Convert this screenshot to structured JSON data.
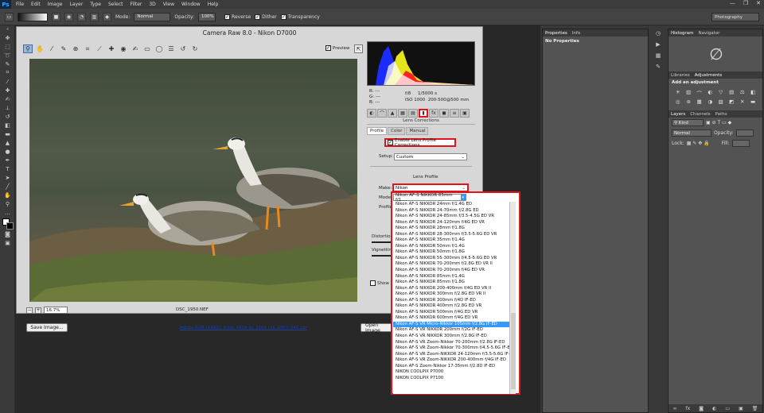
{
  "app": {
    "logo": "Ps"
  },
  "menu": [
    "File",
    "Edit",
    "Image",
    "Layer",
    "Type",
    "Select",
    "Filter",
    "3D",
    "View",
    "Window",
    "Help"
  ],
  "window_controls": [
    "—",
    "❐",
    "✕"
  ],
  "options": {
    "mode_label": "Mode:",
    "mode_value": "Normal",
    "opacity_label": "Opacity:",
    "opacity_value": "100%",
    "reverse": "Reverse",
    "dither": "Dither",
    "transparency": "Transparency",
    "workspace": "Photography"
  },
  "camera_raw": {
    "title": "Camera Raw 8.0  -  Nikon D7000",
    "preview_label": "Preview",
    "zoom_value": "16.7%",
    "filename": "DSC_1950.NEF",
    "save_label": "Save Image...",
    "workflow_link": "Adobe RGB (1998); 8 bit; 4928 by 3264 (16.1MP); 240 ppi",
    "open_label": "Open Image",
    "rgb": {
      "r": "R:  ---",
      "g": "G:  ---",
      "b": "B:  ---"
    },
    "exif": {
      "aperture": "f/8",
      "shutter": "1/5000 s",
      "iso": "ISO 1000",
      "lens": "200-500@500 mm"
    },
    "panel_name": "Lens Corrections",
    "subtabs": [
      "Profile",
      "Color",
      "Manual"
    ],
    "enable_label": "Enable Lens Profile Corrections",
    "setup_label": "Setup:",
    "setup_value": "Custom",
    "lens_profile_heading": "Lens Profile",
    "make_label": "Make:",
    "make_value": "Nikon",
    "model_label": "Model:",
    "model_value": "Nikon AF-S NIKKOR 85mm f/1....",
    "profile_label": "Profile:",
    "distortion_label": "Distortion",
    "vignetting_label": "Vignetting",
    "show_label": "Show G"
  },
  "dropdown": {
    "header": "Nikon AF-S NIKKOR 85mm f/1....",
    "highlighted_index": 20,
    "items": [
      "Nikon AF-S NIKKOR 24mm f/1.4G ED",
      "Nikon AF-S NIKKOR 24-70mm f/2.8G ED",
      "Nikon AF-S NIKKOR 24-85mm f/3.5-4.5G ED VR",
      "Nikon AF-S NIKKOR 24-120mm f/4G ED VR",
      "Nikon AF-S NIKKOR 28mm f/1.8G",
      "Nikon AF-S NIKKOR 28-300mm f/3.5-5.6G ED VR",
      "Nikon AF-S NIKKOR 35mm f/1.4G",
      "Nikon AF-S NIKKOR 50mm f/1.4G",
      "Nikon AF-S NIKKOR 50mm f/1.8G",
      "Nikon AF-S NIKKOR 55-300mm f/4.5-5.6G ED VR",
      "Nikon AF-S NIKKOR 70-200mm f/2.8G ED VR II",
      "Nikon AF-S NIKKOR 70-200mm f/4G ED VR",
      "Nikon AF-S NIKKOR 85mm f/1.4G",
      "Nikon AF-S NIKKOR 85mm f/1.8G",
      "Nikon AF-S NIKKOR 200-400mm f/4G ED VR II",
      "Nikon AF-S NIKKOR 300mm f/2.8G ED VR II",
      "Nikon AF-S NIKKOR 300mm f/4D IF-ED",
      "Nikon AF-S NIKKOR 400mm f/2.8G ED VR",
      "Nikon AF-S NIKKOR 500mm f/4G ED VR",
      "Nikon AF-S NIKKOR 600mm f/4G ED VR",
      "Nikon AF-S VR Micro-Nikkor 105mm f/2.8G IF-ED",
      "Nikon AF-S VR NIKKOR 200mm f/2G IF-ED",
      "Nikon AF-S VR NIKKOR 300mm f/2.8G IF-ED",
      "Nikon AF-S VR Zoom-Nikkor 70-200mm f/2.8G IF-ED",
      "Nikon AF-S VR Zoom-Nikkor 70-300mm f/4.5-5.6G IF-ED",
      "Nikon AF-S VR Zoom-NIKKOR 24-120mm f/3.5-5.6G IF-ED",
      "Nikon AF-S VR Zoom-NIKKOR 200-400mm f/4G IF-ED",
      "Nikon AF-S Zoom-Nikkor 17-35mm f/2.8D IF-ED",
      "NIKON COOLPIX P7000",
      "NIKON COOLPIX P7100"
    ]
  },
  "panels": {
    "properties_tabs": [
      "Properties",
      "Info"
    ],
    "no_properties": "No Properties",
    "histogram_tabs": [
      "Histogram",
      "Navigator"
    ],
    "adjust_tabs": [
      "Libraries",
      "Adjustments"
    ],
    "add_adjustment": "Add an adjustment",
    "layers_tabs": [
      "Layers",
      "Channels",
      "Paths"
    ],
    "kind_label": "Kind",
    "blend_value": "Normal",
    "opacity_label": "Opacity:",
    "lock_label": "Lock:",
    "fill_label": "Fill:"
  },
  "colors": {
    "highlight": "#3399ff",
    "callout": "#e0141a"
  }
}
